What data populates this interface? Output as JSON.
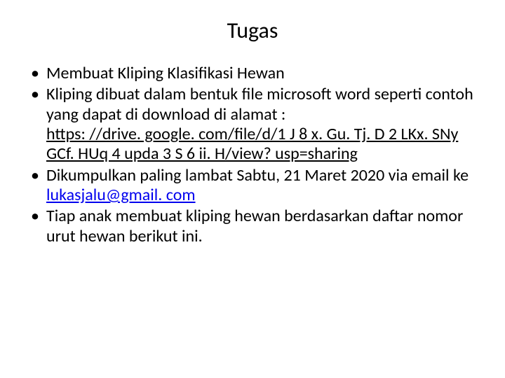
{
  "title": "Tugas",
  "items": [
    {
      "text": "Membuat Kliping Klasifikasi Hewan"
    },
    {
      "text": "Kliping dibuat dalam bentuk file microsoft word seperti contoh yang dapat di download di alamat : ",
      "link": "https: //drive. google. com/file/d/1 J 8 x. Gu. Tj. D 2 LKx. SNy GCf. HUq 4 upda 3 S 6 ii. H/view? usp=sharing"
    },
    {
      "text": "Dikumpulkan paling lambat Sabtu, 21 Maret 2020 via email ke ",
      "link": "lukasjalu@gmail. com"
    },
    {
      "text": "Tiap anak membuat kliping hewan berdasarkan daftar nomor urut hewan berikut ini."
    }
  ]
}
